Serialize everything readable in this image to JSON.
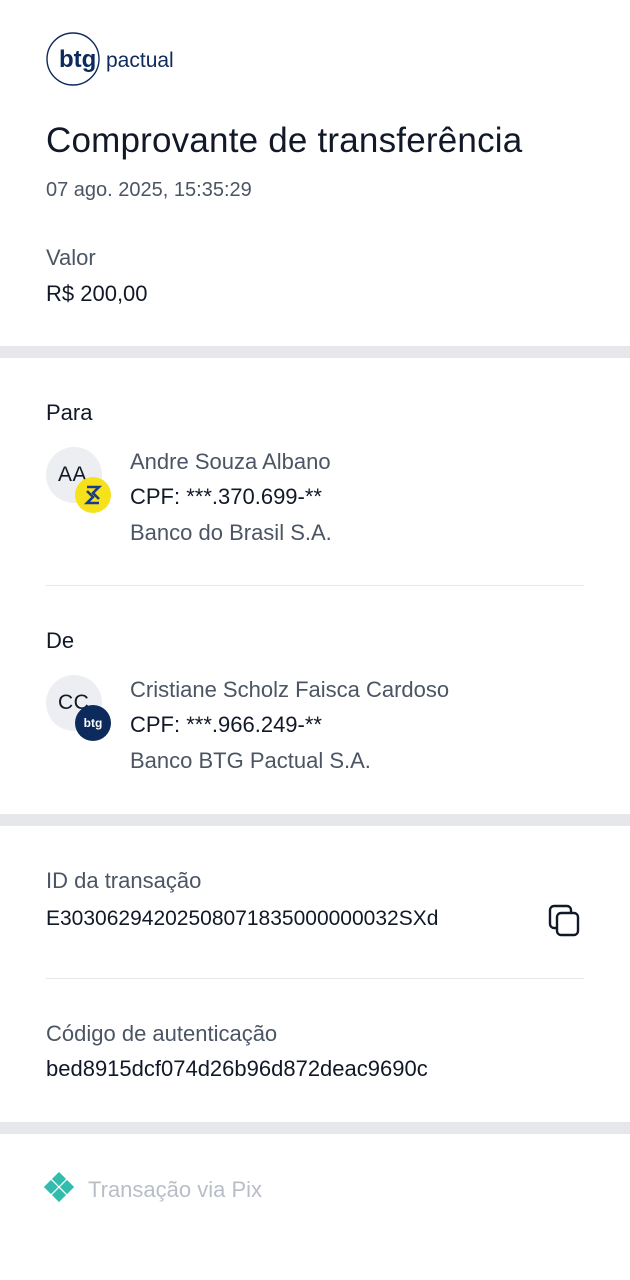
{
  "brand": {
    "logo_text_bold": "btg",
    "logo_text_light": "pactual"
  },
  "header": {
    "title": "Comprovante de transferência",
    "date": "07 ago. 2025, 15:35:29"
  },
  "amount": {
    "label": "Valor",
    "value": "R$ 200,00"
  },
  "recipient": {
    "section_label": "Para",
    "initials": "AA",
    "name": "Andre Souza Albano",
    "document": "CPF: ***.370.699-**",
    "bank": "Banco do Brasil S.A.",
    "bank_icon": "banco-do-brasil-logo-icon"
  },
  "sender": {
    "section_label": "De",
    "initials": "CC",
    "name": "Cristiane Scholz Faisca Cardoso",
    "document": "CPF: ***.966.249-**",
    "bank": "Banco BTG Pactual S.A.",
    "bank_badge_text": "btg",
    "bank_icon": "btg-logo-icon"
  },
  "transaction": {
    "id_label": "ID da transação",
    "id_value": "E30306294202508071835000000032SXd",
    "copy_icon": "copy-icon",
    "auth_label": "Código de autenticação",
    "auth_value": "bed8915dcf074d26b96d872deac9690c"
  },
  "footer": {
    "label": "Transação via Pix",
    "icon": "pix-icon"
  },
  "colors": {
    "text_primary": "#111827",
    "text_secondary": "#4b5563",
    "brand_navy": "#0d2a5c",
    "bb_yellow": "#f7e11a",
    "pix_teal": "#32bcad",
    "separator": "#e5e7eb"
  }
}
